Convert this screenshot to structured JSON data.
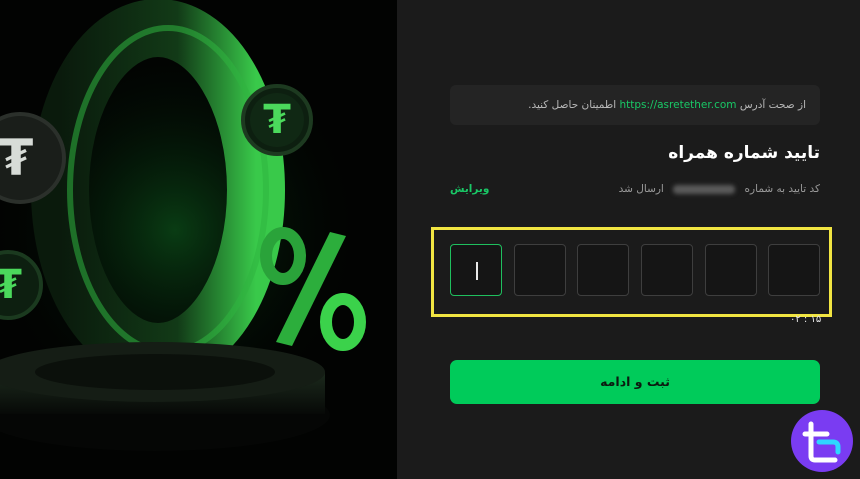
{
  "hero": {
    "big_digit": "0",
    "percent": "%",
    "coin_symbol": "₮",
    "coin_icon": "tether-coin-icon"
  },
  "form": {
    "notice_prefix": "از صحت آدرس",
    "notice_link": "https://asretether.com",
    "notice_suffix": "اطمینان حاصل کنید.",
    "title": "تایید شماره همراه",
    "code_sent_prefix": "کد تایید به شماره",
    "code_sent_suffix": "ارسال شد",
    "edit_label": "ویرایش",
    "otp_digits": [
      "",
      "",
      "",
      "",
      "",
      ""
    ],
    "timer": "۰۲ : ۱۵",
    "submit_label": "ثبت و ادامه"
  },
  "colors": {
    "accent": "#00cb5a",
    "link": "#19c866",
    "highlight": "#f1e542",
    "panel_bg": "#1b1b1b"
  },
  "logo": {
    "icon": "brand-logo-icon"
  }
}
